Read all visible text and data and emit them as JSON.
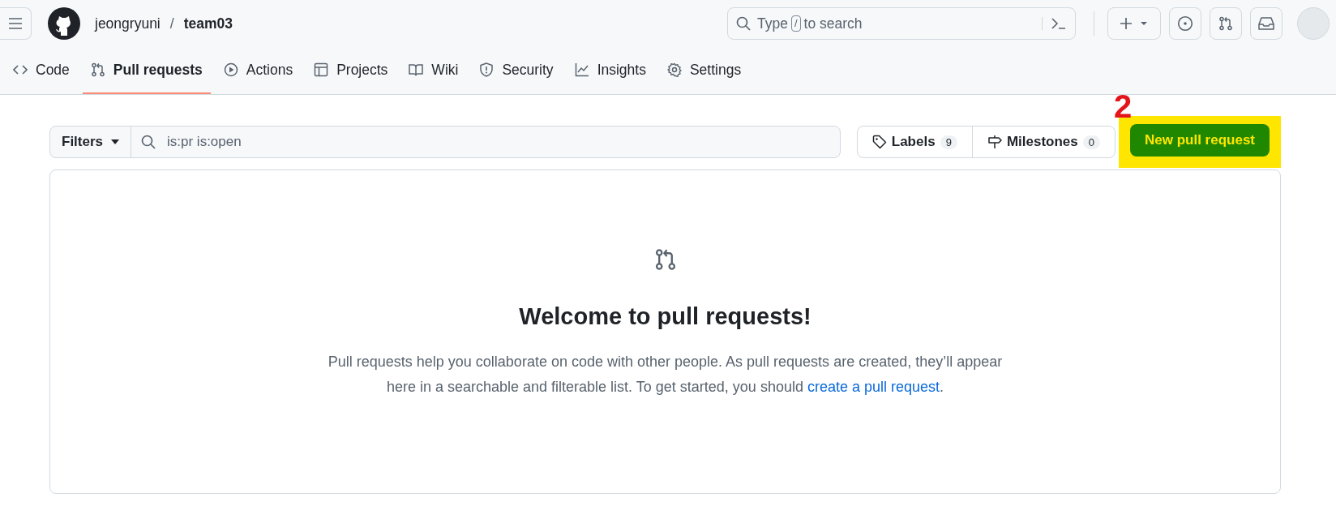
{
  "header": {
    "owner": "jeongryuni",
    "separator": "/",
    "repo": "team03",
    "search": {
      "placeholder_before": "Type",
      "key": "/",
      "placeholder_after": "to search"
    }
  },
  "tabs": [
    {
      "label": "Code",
      "kind": "code",
      "selected": false
    },
    {
      "label": "Pull requests",
      "kind": "pr",
      "selected": true
    },
    {
      "label": "Actions",
      "kind": "play",
      "selected": false
    },
    {
      "label": "Projects",
      "kind": "table",
      "selected": false
    },
    {
      "label": "Wiki",
      "kind": "book",
      "selected": false
    },
    {
      "label": "Security",
      "kind": "shield",
      "selected": false
    },
    {
      "label": "Insights",
      "kind": "graph",
      "selected": false
    },
    {
      "label": "Settings",
      "kind": "gear",
      "selected": false
    }
  ],
  "toolbar": {
    "filters": "Filters",
    "query": "is:pr is:open",
    "labels": {
      "label": "Labels",
      "count": "9"
    },
    "milestones": {
      "label": "Milestones",
      "count": "0"
    },
    "new_button": "New pull request",
    "annotation": "2"
  },
  "blankslate": {
    "title": "Welcome to pull requests!",
    "text": "Pull requests help you collaborate on code with other people. As pull requests are created, they’ll appear here in a searchable and filterable list. To get started, you should ",
    "link": "create a pull request",
    "end": "."
  }
}
